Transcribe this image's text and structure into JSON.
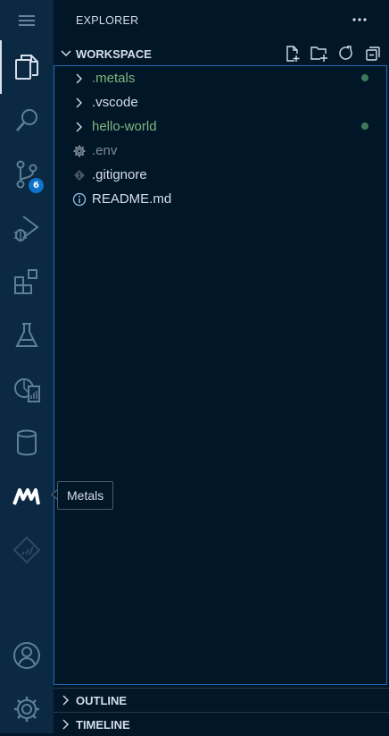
{
  "activity_bar": {
    "items": [
      {
        "name": "explorer",
        "icon": "files-icon",
        "active": true
      },
      {
        "name": "search",
        "icon": "search-icon"
      },
      {
        "name": "source-control",
        "icon": "source-control-icon",
        "badge": "6"
      },
      {
        "name": "run-and-debug",
        "icon": "run-debug-icon"
      },
      {
        "name": "extensions",
        "icon": "extensions-icon"
      },
      {
        "name": "testing",
        "icon": "flask-icon"
      },
      {
        "name": "remote-explorer",
        "icon": "remote-report-icon"
      },
      {
        "name": "database",
        "icon": "database-icon"
      },
      {
        "name": "metals",
        "icon": "metals-icon"
      },
      {
        "name": "gitlens",
        "icon": "diamond-chart-icon"
      }
    ],
    "bottom": [
      {
        "name": "accounts",
        "icon": "account-icon"
      },
      {
        "name": "manage",
        "icon": "gear-icon"
      }
    ],
    "tooltip": "Metals"
  },
  "sidebar": {
    "title": "EXPLORER",
    "workspace": {
      "label": "WORKSPACE",
      "actions": [
        "new-file-icon",
        "new-folder-icon",
        "refresh-icon",
        "collapse-all-icon"
      ],
      "items": [
        {
          "label": ".metals",
          "type": "folder",
          "color": "green",
          "modified": true
        },
        {
          "label": ".vscode",
          "type": "folder",
          "color": "white",
          "modified": false
        },
        {
          "label": "hello-world",
          "type": "folder",
          "color": "green",
          "modified": true
        },
        {
          "label": ".env",
          "type": "gear-file",
          "color": "muted",
          "modified": false
        },
        {
          "label": ".gitignore",
          "type": "git-file",
          "color": "white",
          "modified": false
        },
        {
          "label": "README.md",
          "type": "info-file",
          "color": "white",
          "modified": false
        }
      ]
    },
    "outline": {
      "label": "OUTLINE"
    },
    "timeline": {
      "label": "TIMELINE"
    }
  },
  "colors": {
    "background": "#011627",
    "activity_bar": "#0b2942",
    "accent": "#1f6fbd",
    "badge": "#0e73c9",
    "modified_green": "#7fb77e",
    "icon": "#5f7e97"
  }
}
